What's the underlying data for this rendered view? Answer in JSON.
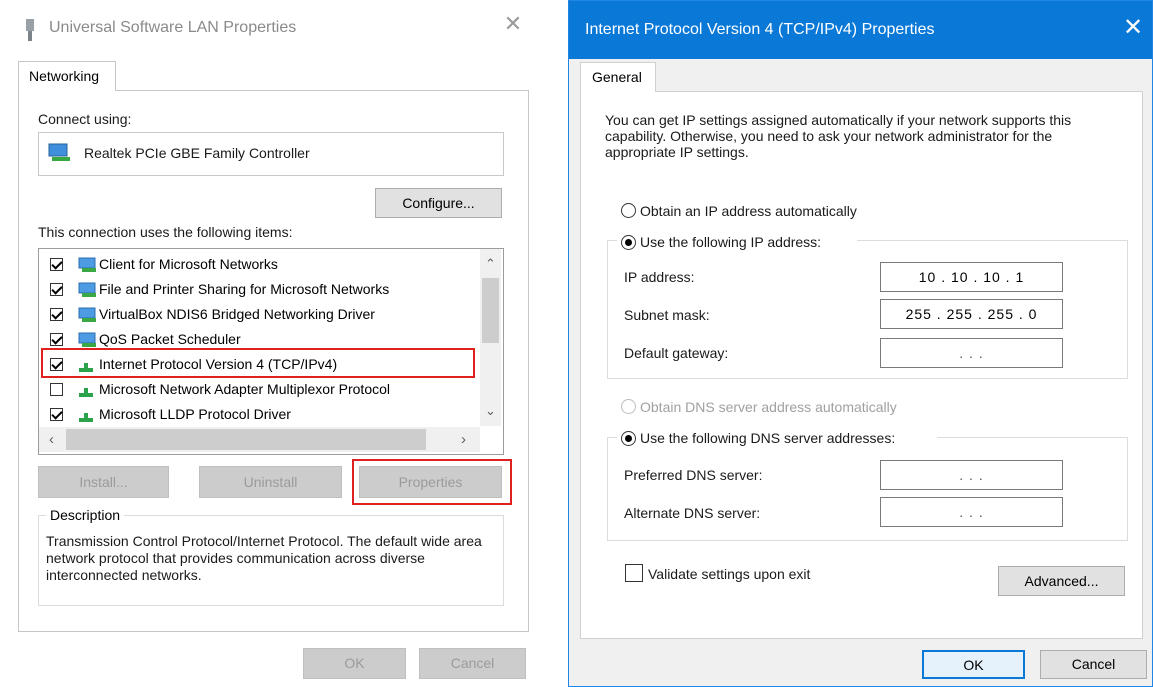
{
  "left_dialog": {
    "title": "Universal Software LAN Properties",
    "tab": "Networking",
    "connect_using_label": "Connect using:",
    "adapter_name": "Realtek PCIe GBE Family Controller",
    "configure_button": "Configure...",
    "items_label": "This connection uses the following items:",
    "items": [
      {
        "label": "Client for Microsoft Networks",
        "checked": true,
        "icon": "network-client-icon"
      },
      {
        "label": "File and Printer Sharing for Microsoft Networks",
        "checked": true,
        "icon": "network-service-icon"
      },
      {
        "label": "VirtualBox NDIS6 Bridged Networking Driver",
        "checked": true,
        "icon": "network-service-icon"
      },
      {
        "label": "QoS Packet Scheduler",
        "checked": true,
        "icon": "network-service-icon"
      },
      {
        "label": "Internet Protocol Version 4 (TCP/IPv4)",
        "checked": true,
        "icon": "protocol-icon"
      },
      {
        "label": "Microsoft Network Adapter Multiplexor Protocol",
        "checked": false,
        "icon": "protocol-icon"
      },
      {
        "label": "Microsoft LLDP Protocol Driver",
        "checked": true,
        "icon": "protocol-icon"
      }
    ],
    "install_button": "Install...",
    "uninstall_button": "Uninstall",
    "properties_button": "Properties",
    "description_label": "Description",
    "description_text": "Transmission Control Protocol/Internet Protocol. The default wide area network protocol that provides communication across diverse interconnected networks.",
    "ok_button": "OK",
    "cancel_button": "Cancel",
    "colors": {
      "highlight": "#e0201c"
    }
  },
  "right_dialog": {
    "title": "Internet Protocol Version 4 (TCP/IPv4) Properties",
    "tab": "General",
    "intro_text": "You can get IP settings assigned automatically if your network supports this capability. Otherwise, you need to ask your network administrator for the appropriate IP settings.",
    "ip_auto_label": "Obtain an IP address automatically",
    "ip_manual_label": "Use the following IP address:",
    "ip_address_label": "IP address:",
    "ip_address_value": "10  .  10  .  10  .  1",
    "subnet_label": "Subnet mask:",
    "subnet_value": "255 . 255 . 255 .  0",
    "gateway_label": "Default gateway:",
    "gateway_value": ".        .        .",
    "dns_auto_label": "Obtain DNS server address automatically",
    "dns_manual_label": "Use the following DNS server addresses:",
    "preferred_dns_label": "Preferred DNS server:",
    "preferred_dns_value": ".        .        .",
    "alternate_dns_label": "Alternate DNS server:",
    "alternate_dns_value": ".        .        .",
    "validate_label": "Validate settings upon exit",
    "advanced_button": "Advanced...",
    "ok_button": "OK",
    "cancel_button": "Cancel",
    "selected_ip_mode": "manual",
    "selected_dns_mode": "manual",
    "colors": {
      "titlebar": "#0a78d7"
    }
  }
}
